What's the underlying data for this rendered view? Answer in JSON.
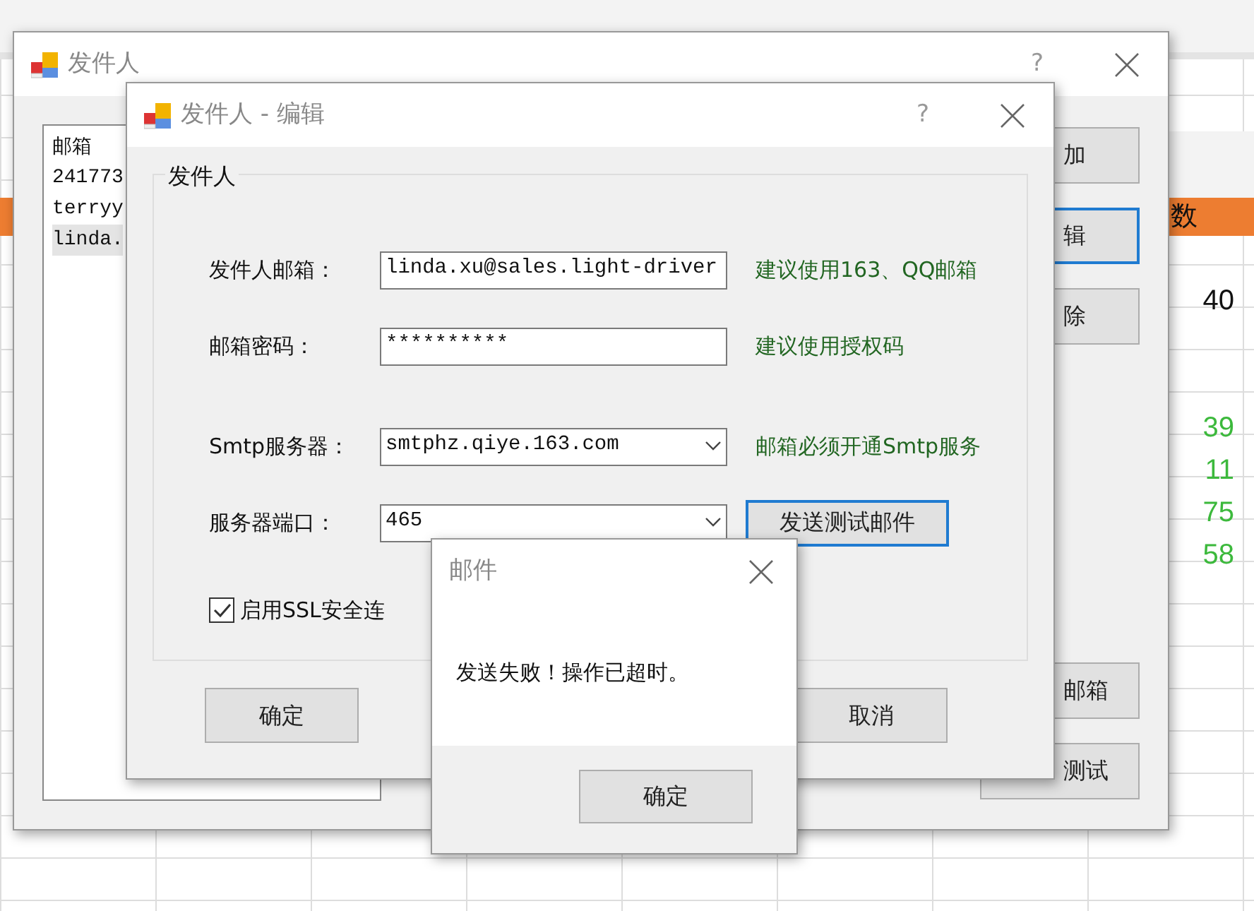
{
  "spreadsheet": {
    "header_cell": "数",
    "cells": [
      {
        "text": "40",
        "kind": "plain"
      },
      {
        "text": "39",
        "kind": "positive"
      },
      {
        "text": "11",
        "kind": "positive"
      },
      {
        "text": "75",
        "kind": "positive"
      },
      {
        "text": "58",
        "kind": "positive"
      }
    ]
  },
  "sender_window": {
    "title": "发件人",
    "help": "?",
    "list": [
      {
        "text": "邮箱",
        "selected": false
      },
      {
        "text": "241773",
        "selected": false
      },
      {
        "text": "terryy",
        "selected": false
      },
      {
        "text": "linda.",
        "selected": true
      }
    ],
    "buttons": [
      {
        "label": "加",
        "focused": false
      },
      {
        "label": "辑",
        "focused": true
      },
      {
        "label": "除",
        "focused": false
      },
      {
        "label": "邮箱",
        "focused": false
      },
      {
        "label": "测试",
        "focused": false
      }
    ]
  },
  "edit_dialog": {
    "title": "发件人 - 编辑",
    "help": "?",
    "group_title": "发件人",
    "fields": [
      {
        "label": "发件人邮箱：",
        "kind": "text",
        "value": "linda.xu@sales.light-driver",
        "hint": "建议使用163、QQ邮箱"
      },
      {
        "label": "邮箱密码：",
        "kind": "password",
        "value": "**********",
        "hint": "建议使用授权码"
      },
      {
        "label": "Smtp服务器：",
        "kind": "combo",
        "value": "smtphz.qiye.163.com",
        "hint": "邮箱必须开通Smtp服务"
      },
      {
        "label": "服务器端口：",
        "kind": "combo",
        "value": "465",
        "button": "发送测试邮件"
      }
    ],
    "ssl": {
      "label": "启用SSL安全连",
      "checked": true
    },
    "ok": "确定",
    "cancel": "取消"
  },
  "message_box": {
    "title": "邮件",
    "message": "发送失败！操作已超时。",
    "ok": "确定"
  }
}
